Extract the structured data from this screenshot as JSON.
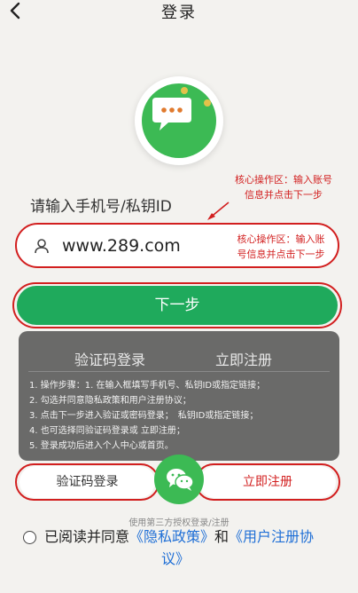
{
  "header": {
    "title": "登录"
  },
  "form": {
    "phone_label": "请输入手机号/私钥ID",
    "phone_value": "www.289.com",
    "next_label": "下一步"
  },
  "annotations": {
    "top_line1": "核心操作区：输入账号",
    "top_line2": "信息并点击下一步",
    "input_line1": "核心操作区：输入账",
    "input_line2": "号信息并点击下一步",
    "color": "#d21f1f"
  },
  "panel": {
    "tab1": "验证码登录",
    "tab2": "立即注册",
    "steps": [
      "1. 操作步骤：1. 在输入框填写手机号、私钥ID或指定链接；",
      "2. 勾选并同意隐私政策和用户注册协议；",
      "3. 点击下一步进入验证或密码登录；　私钥ID或指定链接；",
      "4. 也可选择同验证码登录或 立即注册；",
      "5. 登录成功后进入个人中心或首页。"
    ]
  },
  "bottom": {
    "sms_label": "验证码登录",
    "register_label": "立即注册",
    "third_party": "使用第三方授权登录/注册"
  },
  "agreement": {
    "prefix": "已阅读并同意",
    "privacy": "《隐私政策》",
    "and": "和",
    "terms_part1": "《用户注册协",
    "terms_part2": "议》"
  },
  "colors": {
    "brand_green": "#1faa5c",
    "accent_red": "#d21f1f",
    "link_blue": "#1f6fd6"
  },
  "icons": {
    "back": "chevron-left-icon",
    "logo": "chat-bubble-icon",
    "user": "user-icon",
    "wechat": "wechat-icon"
  }
}
